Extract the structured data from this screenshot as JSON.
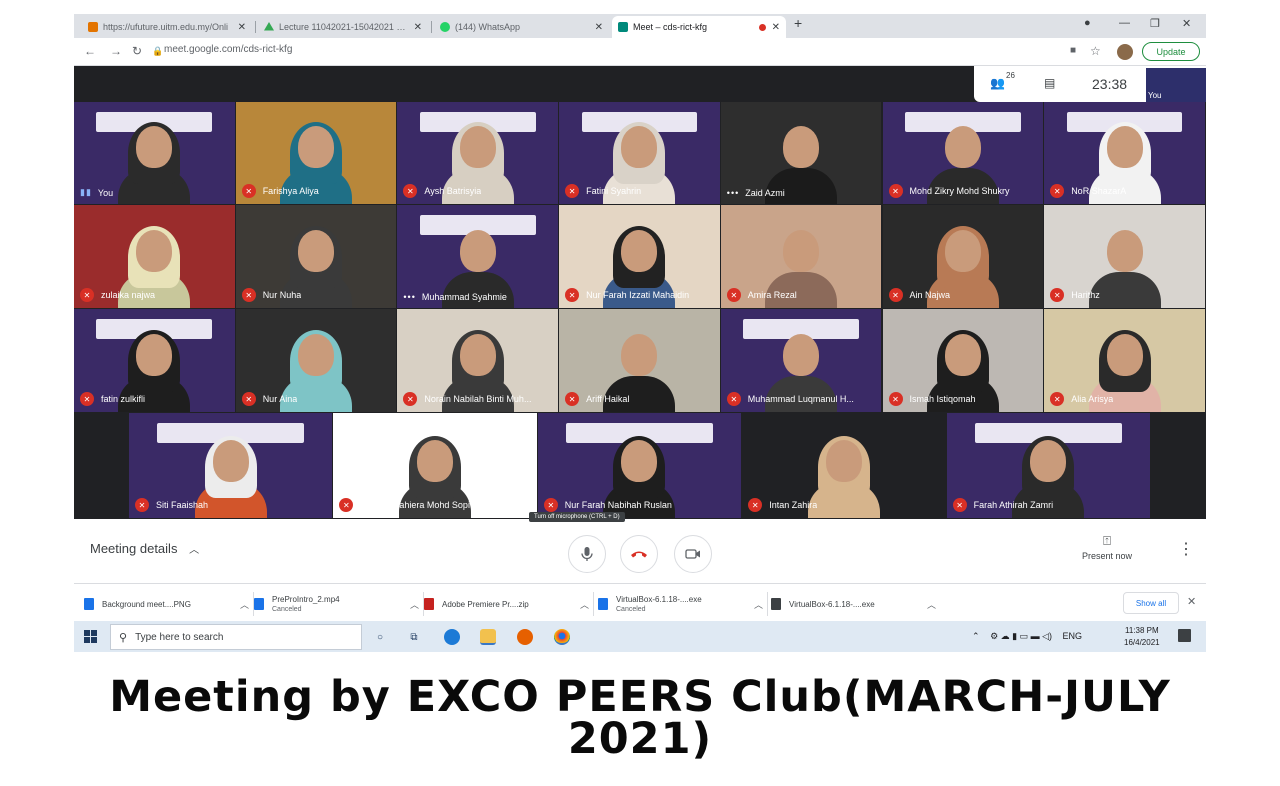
{
  "browser": {
    "tabs": [
      {
        "title": "https://ufuture.uitm.edu.my/Onli",
        "icon": "ufuture-favicon",
        "color": "#e37400"
      },
      {
        "title": "Lecture 11042021-15042021 - G",
        "icon": "google-drive-favicon",
        "color": "#34a853"
      },
      {
        "title": "(144) WhatsApp",
        "icon": "whatsapp-favicon",
        "color": "#25d366"
      },
      {
        "title": "Meet – cds-rict-kfg",
        "icon": "google-meet-favicon",
        "color": "#00897b",
        "active": true
      }
    ],
    "url": "meet.google.com/cds-rict-kfg",
    "update_label": "Update"
  },
  "meet": {
    "participant_count": "26",
    "time": "23:38",
    "self_label": "You",
    "tooltip": "Turn off microphone (CTRL + D)",
    "meeting_details_label": "Meeting details",
    "present_now_label": "Present now"
  },
  "participants": [
    {
      "name": "You",
      "status": "speaking",
      "bg": "#3a2a66",
      "banner": true,
      "hijab": "#2b2b2b",
      "body": "#2b2b2b"
    },
    {
      "name": "Farishya Aliya",
      "status": "muted",
      "bg": "#b8873a",
      "banner": false,
      "hijab": "#1f6f86",
      "body": "#1f6f86"
    },
    {
      "name": "Aysh Batrisyia",
      "status": "muted",
      "bg": "#3a2a66",
      "banner": true,
      "hijab": "#d7cfc2",
      "body": "#d7cfc2"
    },
    {
      "name": "Fatini Syahrin",
      "status": "muted",
      "bg": "#3a2a66",
      "banner": true,
      "hijab": "#d9d2c8",
      "body": "#e8e0d6"
    },
    {
      "name": "Zaid Azmi",
      "status": "dots",
      "bg": "#2e2e2e",
      "banner": false,
      "hijab": "",
      "body": "#1b1b1b"
    },
    {
      "name": "Mohd Zikry Mohd Shukry",
      "status": "muted",
      "bg": "#3a2a66",
      "banner": true,
      "hijab": "",
      "body": "#2a2a2a"
    },
    {
      "name": "NoR ShazarA",
      "status": "muted",
      "bg": "#3a2a66",
      "banner": true,
      "hijab": "#f2f2f2",
      "body": "#f2f2f2"
    },
    {
      "name": "zulaika najwa",
      "status": "muted",
      "bg": "#9a2c2c",
      "banner": false,
      "hijab": "#e8e2b8",
      "body": "#c8c79b"
    },
    {
      "name": "Nur Nuha",
      "status": "muted",
      "bg": "#3d3a36",
      "banner": false,
      "hijab": "#3a3a3a",
      "body": "#3a3a3a"
    },
    {
      "name": "Muhammad Syahmie",
      "status": "dots",
      "bg": "#3a2a66",
      "banner": true,
      "hijab": "",
      "body": "#2a2a2a"
    },
    {
      "name": "Nur Farah Izzati Mahaidin",
      "status": "muted",
      "bg": "#e4d6c4",
      "banner": false,
      "hijab": "#222222",
      "body": "#3a5a8a"
    },
    {
      "name": "Amira Rezal",
      "status": "muted",
      "bg": "#c9a48a",
      "banner": false,
      "hijab": "",
      "body": "#8c6a5a"
    },
    {
      "name": "Ain Najwa",
      "status": "muted",
      "bg": "#2a2a2a",
      "banner": false,
      "hijab": "#b87a55",
      "body": "#b87a55"
    },
    {
      "name": "Harithz",
      "status": "muted",
      "bg": "#d8d4cf",
      "banner": false,
      "hijab": "",
      "body": "#3a3a3a"
    },
    {
      "name": "fatin zulkifli",
      "status": "muted",
      "bg": "#3a2a66",
      "banner": true,
      "hijab": "#1e1e1e",
      "body": "#1e1e1e"
    },
    {
      "name": "Nur Aina",
      "status": "muted",
      "bg": "#2e2e2e",
      "banner": false,
      "hijab": "#7ec4c6",
      "body": "#7ec4c6"
    },
    {
      "name": "Norain Nabilah Binti Muh...",
      "status": "muted",
      "bg": "#d8d0c4",
      "banner": false,
      "hijab": "#3a3a3a",
      "body": "#3a3a3a"
    },
    {
      "name": "Ariff Haikal",
      "status": "muted",
      "bg": "#b9b4a6",
      "banner": false,
      "hijab": "",
      "body": "#1e1e1e"
    },
    {
      "name": "Muhammad Luqmanul H...",
      "status": "muted",
      "bg": "#3a2a66",
      "banner": true,
      "hijab": "",
      "body": "#3a3a3a"
    },
    {
      "name": "Ismah Istiqomah",
      "status": "muted",
      "bg": "#bdb8b3",
      "banner": false,
      "hijab": "#1e1e1e",
      "body": "#1e1e1e"
    },
    {
      "name": "Alia Arisya",
      "status": "muted",
      "bg": "#d6c8a4",
      "banner": false,
      "hijab": "#2a2a2a",
      "body": "#e1b3a7"
    },
    {
      "name": "Siti Faaishah",
      "status": "muted",
      "bg": "#3a2a66",
      "banner": true,
      "hijab": "#ececec",
      "body": "#d2552b"
    },
    {
      "name": "Nik Norsyahiera Mohd Sopi",
      "status": "muted",
      "bg": "#ffffff",
      "banner": false,
      "hijab": "#3a3a3a",
      "body": "#3a3a3a"
    },
    {
      "name": "Nur Farah Nabihah Ruslan",
      "status": "muted",
      "bg": "#3a2a66",
      "banner": true,
      "hijab": "#1e1e1e",
      "body": "#1e1e1e"
    },
    {
      "name": "Intan Zahira",
      "status": "muted",
      "bg": "#202124",
      "banner": false,
      "hijab": "#d6b48c",
      "body": "#d6b48c"
    },
    {
      "name": "Farah Athirah Zamri",
      "status": "muted",
      "bg": "#3a2a66",
      "banner": true,
      "hijab": "#2a2a2a",
      "body": "#2a2a2a"
    }
  ],
  "downloads": [
    {
      "name": "Background meet....PNG",
      "sub": "",
      "icon": "image-file-icon",
      "color": "#1a73e8"
    },
    {
      "name": "PreProIntro_2.mp4",
      "sub": "Canceled",
      "icon": "video-file-icon",
      "color": "#1a73e8"
    },
    {
      "name": "Adobe Premiere Pr....zip",
      "sub": "",
      "icon": "zip-file-icon",
      "color": "#c5221f"
    },
    {
      "name": "VirtualBox-6.1.18-....exe",
      "sub": "Canceled",
      "icon": "exe-file-icon",
      "color": "#1a73e8"
    },
    {
      "name": "VirtualBox-6.1.18-....exe",
      "sub": "",
      "icon": "shield-exe-icon",
      "color": "#3c4043"
    }
  ],
  "download_show_all": "Show all",
  "taskbar": {
    "search_placeholder": "Type here to search",
    "language": "ENG",
    "time": "11:38 PM",
    "date": "16/4/2021"
  },
  "caption": "Meeting by EXCO PEERS Club(MARCH-JULY 2021)"
}
